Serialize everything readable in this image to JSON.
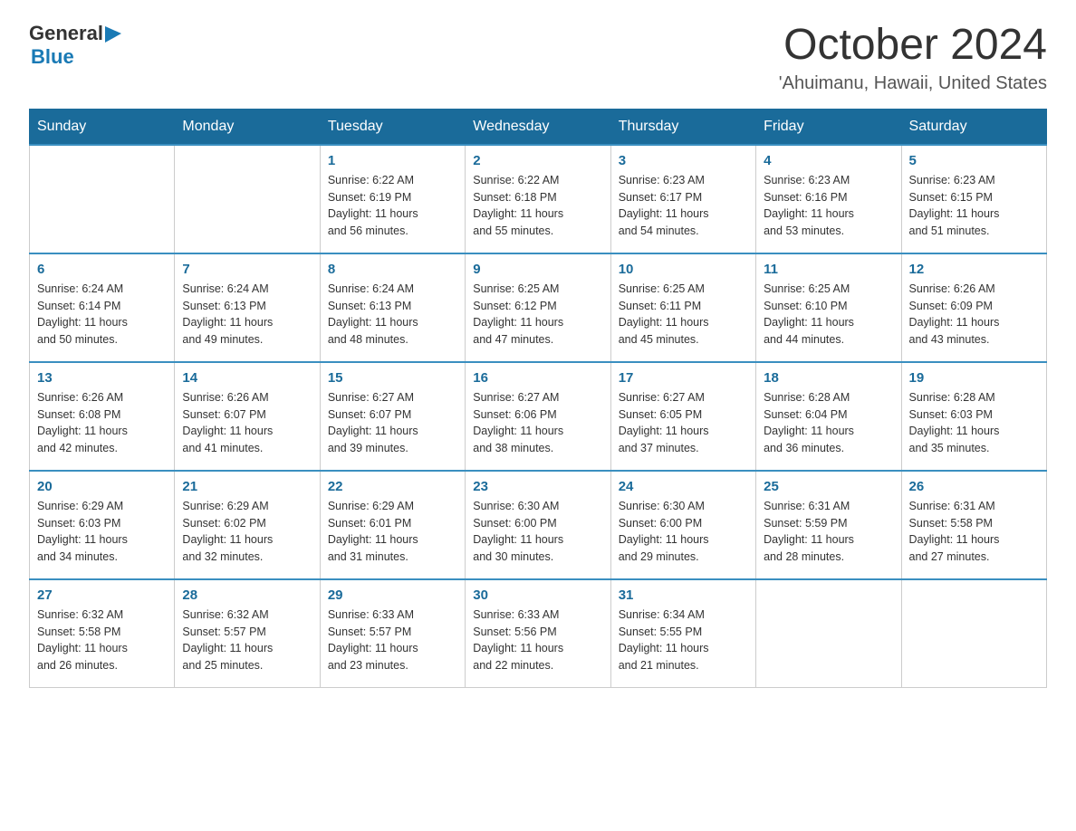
{
  "logo": {
    "general": "General",
    "arrow": "▶",
    "blue": "Blue"
  },
  "title": "October 2024",
  "location": "'Ahuimanu, Hawaii, United States",
  "days_of_week": [
    "Sunday",
    "Monday",
    "Tuesday",
    "Wednesday",
    "Thursday",
    "Friday",
    "Saturday"
  ],
  "weeks": [
    [
      {
        "day": "",
        "info": ""
      },
      {
        "day": "",
        "info": ""
      },
      {
        "day": "1",
        "info": "Sunrise: 6:22 AM\nSunset: 6:19 PM\nDaylight: 11 hours\nand 56 minutes."
      },
      {
        "day": "2",
        "info": "Sunrise: 6:22 AM\nSunset: 6:18 PM\nDaylight: 11 hours\nand 55 minutes."
      },
      {
        "day": "3",
        "info": "Sunrise: 6:23 AM\nSunset: 6:17 PM\nDaylight: 11 hours\nand 54 minutes."
      },
      {
        "day": "4",
        "info": "Sunrise: 6:23 AM\nSunset: 6:16 PM\nDaylight: 11 hours\nand 53 minutes."
      },
      {
        "day": "5",
        "info": "Sunrise: 6:23 AM\nSunset: 6:15 PM\nDaylight: 11 hours\nand 51 minutes."
      }
    ],
    [
      {
        "day": "6",
        "info": "Sunrise: 6:24 AM\nSunset: 6:14 PM\nDaylight: 11 hours\nand 50 minutes."
      },
      {
        "day": "7",
        "info": "Sunrise: 6:24 AM\nSunset: 6:13 PM\nDaylight: 11 hours\nand 49 minutes."
      },
      {
        "day": "8",
        "info": "Sunrise: 6:24 AM\nSunset: 6:13 PM\nDaylight: 11 hours\nand 48 minutes."
      },
      {
        "day": "9",
        "info": "Sunrise: 6:25 AM\nSunset: 6:12 PM\nDaylight: 11 hours\nand 47 minutes."
      },
      {
        "day": "10",
        "info": "Sunrise: 6:25 AM\nSunset: 6:11 PM\nDaylight: 11 hours\nand 45 minutes."
      },
      {
        "day": "11",
        "info": "Sunrise: 6:25 AM\nSunset: 6:10 PM\nDaylight: 11 hours\nand 44 minutes."
      },
      {
        "day": "12",
        "info": "Sunrise: 6:26 AM\nSunset: 6:09 PM\nDaylight: 11 hours\nand 43 minutes."
      }
    ],
    [
      {
        "day": "13",
        "info": "Sunrise: 6:26 AM\nSunset: 6:08 PM\nDaylight: 11 hours\nand 42 minutes."
      },
      {
        "day": "14",
        "info": "Sunrise: 6:26 AM\nSunset: 6:07 PM\nDaylight: 11 hours\nand 41 minutes."
      },
      {
        "day": "15",
        "info": "Sunrise: 6:27 AM\nSunset: 6:07 PM\nDaylight: 11 hours\nand 39 minutes."
      },
      {
        "day": "16",
        "info": "Sunrise: 6:27 AM\nSunset: 6:06 PM\nDaylight: 11 hours\nand 38 minutes."
      },
      {
        "day": "17",
        "info": "Sunrise: 6:27 AM\nSunset: 6:05 PM\nDaylight: 11 hours\nand 37 minutes."
      },
      {
        "day": "18",
        "info": "Sunrise: 6:28 AM\nSunset: 6:04 PM\nDaylight: 11 hours\nand 36 minutes."
      },
      {
        "day": "19",
        "info": "Sunrise: 6:28 AM\nSunset: 6:03 PM\nDaylight: 11 hours\nand 35 minutes."
      }
    ],
    [
      {
        "day": "20",
        "info": "Sunrise: 6:29 AM\nSunset: 6:03 PM\nDaylight: 11 hours\nand 34 minutes."
      },
      {
        "day": "21",
        "info": "Sunrise: 6:29 AM\nSunset: 6:02 PM\nDaylight: 11 hours\nand 32 minutes."
      },
      {
        "day": "22",
        "info": "Sunrise: 6:29 AM\nSunset: 6:01 PM\nDaylight: 11 hours\nand 31 minutes."
      },
      {
        "day": "23",
        "info": "Sunrise: 6:30 AM\nSunset: 6:00 PM\nDaylight: 11 hours\nand 30 minutes."
      },
      {
        "day": "24",
        "info": "Sunrise: 6:30 AM\nSunset: 6:00 PM\nDaylight: 11 hours\nand 29 minutes."
      },
      {
        "day": "25",
        "info": "Sunrise: 6:31 AM\nSunset: 5:59 PM\nDaylight: 11 hours\nand 28 minutes."
      },
      {
        "day": "26",
        "info": "Sunrise: 6:31 AM\nSunset: 5:58 PM\nDaylight: 11 hours\nand 27 minutes."
      }
    ],
    [
      {
        "day": "27",
        "info": "Sunrise: 6:32 AM\nSunset: 5:58 PM\nDaylight: 11 hours\nand 26 minutes."
      },
      {
        "day": "28",
        "info": "Sunrise: 6:32 AM\nSunset: 5:57 PM\nDaylight: 11 hours\nand 25 minutes."
      },
      {
        "day": "29",
        "info": "Sunrise: 6:33 AM\nSunset: 5:57 PM\nDaylight: 11 hours\nand 23 minutes."
      },
      {
        "day": "30",
        "info": "Sunrise: 6:33 AM\nSunset: 5:56 PM\nDaylight: 11 hours\nand 22 minutes."
      },
      {
        "day": "31",
        "info": "Sunrise: 6:34 AM\nSunset: 5:55 PM\nDaylight: 11 hours\nand 21 minutes."
      },
      {
        "day": "",
        "info": ""
      },
      {
        "day": "",
        "info": ""
      }
    ]
  ]
}
